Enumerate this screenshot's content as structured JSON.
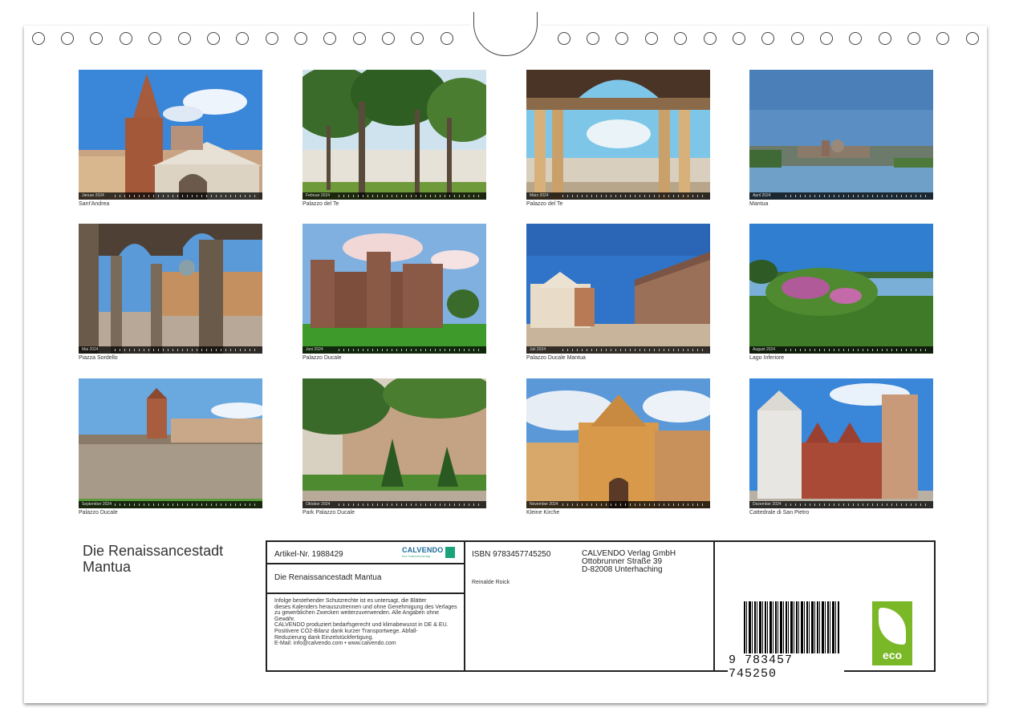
{
  "document": {
    "title": "Die Renaissancestadt Mantua"
  },
  "photos": [
    {
      "caption": "Sant'Andrea",
      "month": "Januar 2024"
    },
    {
      "caption": "Palazzo del Te",
      "month": "Februar 2024"
    },
    {
      "caption": "Palazzo del Te",
      "month": "März 2024"
    },
    {
      "caption": "Mantua",
      "month": "April 2024"
    },
    {
      "caption": "Piazza Sordello",
      "month": "Mai 2024"
    },
    {
      "caption": "Palazzo Ducale",
      "month": "Juni 2024"
    },
    {
      "caption": "Palazzo Ducale Mantua",
      "month": "Juli 2024"
    },
    {
      "caption": "Lago Inferiore",
      "month": "August 2024"
    },
    {
      "caption": "Palazzo Ducale",
      "month": "September 2024"
    },
    {
      "caption": "Park Palazzo Ducale",
      "month": "Oktober 2024"
    },
    {
      "caption": "Kleine Kirche",
      "month": "November 2024"
    },
    {
      "caption": "Cattedrale di San Pietro",
      "month": "Dezember 2024"
    }
  ],
  "info": {
    "article": "Artikel-Nr. 1988429",
    "logo_text": "CALVENDO",
    "logo_sub": "Ihre Kalenderverlag",
    "title": "Die Renaissancestadt Mantua",
    "legal": [
      "Infolge bestehender Schutzrechte ist es untersagt, die Blätter",
      "dieses Kalenders herauszutrennen und ohne Genehmigung des Verlages",
      "zu gewerblichen Zwecken weiterzuverwenden. Alle Angaben ohne",
      "Gewähr.",
      "CALVENDO produziert bedarfsgerecht und klimabewusst in DE & EU.",
      "Positivere CO2-Bilanz dank kurzer Transportwege. Abfall-",
      "Reduzierung dank Einzelstückfertigung.",
      "E-Mail: info@calvendo.com • www.calvendo.com"
    ],
    "isbn": "ISBN 9783457745250",
    "author": "Reinalde Roick",
    "publisher": [
      "CALVENDO Verlag GmbH",
      "Ottobrunner Straße 39",
      "D-82008 Unterhaching"
    ],
    "barcode_number": "9 783457 745250",
    "eco_label": "eco"
  }
}
